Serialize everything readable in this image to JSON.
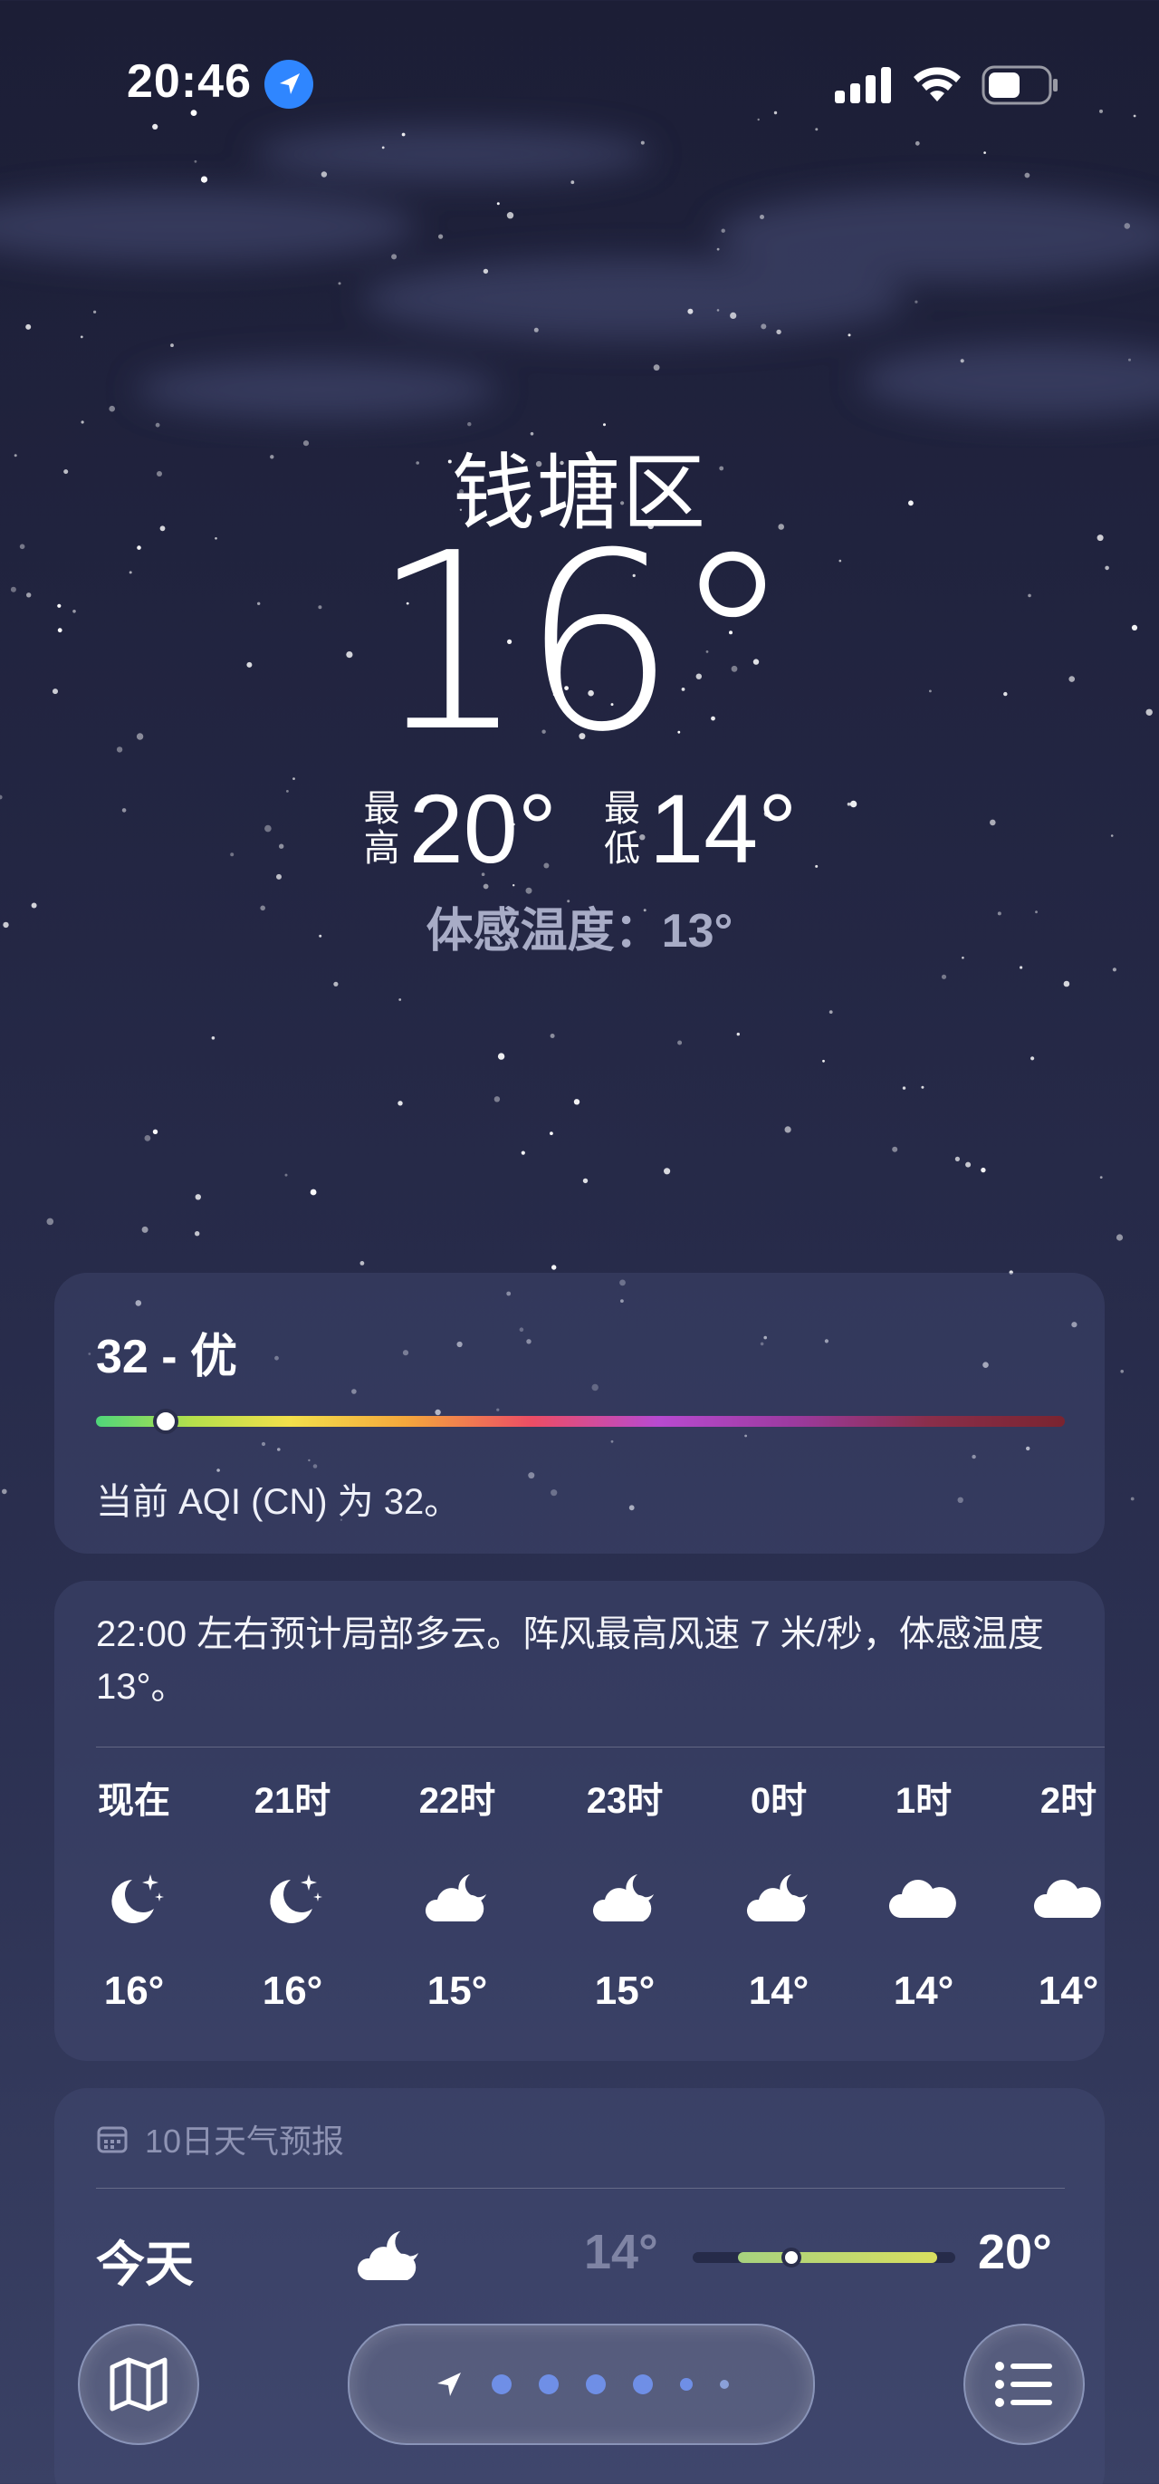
{
  "status_bar": {
    "time": "20:46",
    "icons": [
      "location-arrow-icon",
      "signal-icon",
      "wifi-icon",
      "battery-icon"
    ]
  },
  "header": {
    "location": "钱塘区",
    "current_temp": "16°",
    "high_label": "最高",
    "high_value": "20°",
    "low_label": "最低",
    "low_value": "14°",
    "feels_like": "体感温度：13°"
  },
  "aqi": {
    "title": "32 - 优",
    "level_fraction": 0.07,
    "description": "当前 AQI (CN) 为 32。"
  },
  "hourly": {
    "summary": "22:00 左右预计局部多云。阵风最高风速 7 米/秒，体感温度 13°。",
    "hours": [
      {
        "time": "现在",
        "icon": "moon-stars-icon",
        "temp": "16°"
      },
      {
        "time": "21时",
        "icon": "moon-stars-icon",
        "temp": "16°"
      },
      {
        "time": "22时",
        "icon": "cloud-moon-icon",
        "temp": "15°"
      },
      {
        "time": "23时",
        "icon": "cloud-moon-icon",
        "temp": "15°"
      },
      {
        "time": "0时",
        "icon": "cloud-moon-icon",
        "temp": "14°"
      },
      {
        "time": "1时",
        "icon": "cloud-icon",
        "temp": "14°"
      },
      {
        "time": "2时",
        "icon": "cloud-icon",
        "temp": "14°"
      }
    ]
  },
  "daily": {
    "header": "10日天气预报",
    "days": [
      {
        "name": "今天",
        "icon": "cloud-moon-icon",
        "low": "14°",
        "high": "20°"
      }
    ]
  },
  "toolbar": {
    "map_icon": "map-icon",
    "list_icon": "list-icon",
    "page_count": 7,
    "current_page": 0
  }
}
